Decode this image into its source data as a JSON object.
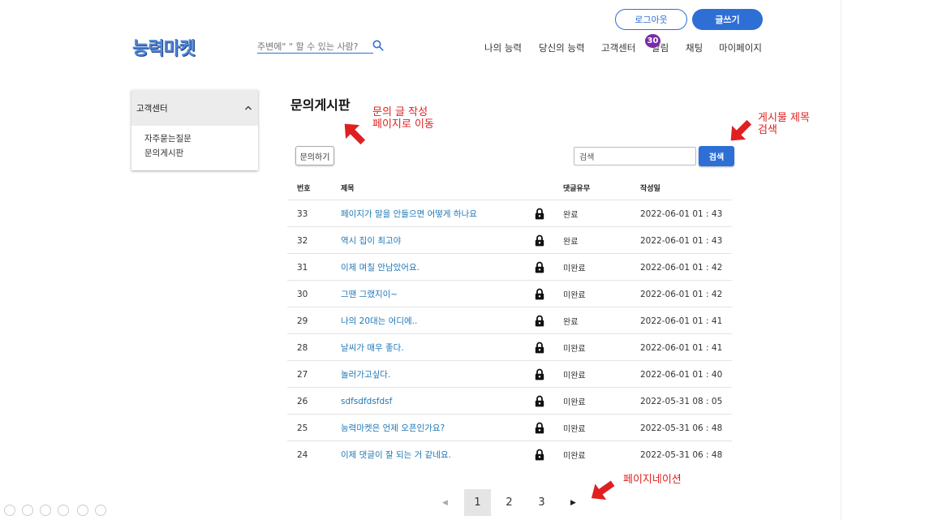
{
  "header": {
    "logout_label": "로그아웃",
    "write_label": "글쓰기",
    "logo_text": "능력마켓",
    "search_placeholder": "주변에\" \" 할 수 있는 사람?",
    "nav": [
      "나의 능력",
      "당신의 능력",
      "고객센터",
      "알림",
      "채팅",
      "마이페이지"
    ],
    "notification_count": "30"
  },
  "sidebar": {
    "title": "고객센터",
    "items": [
      "자주묻는질문",
      "문의게시판"
    ]
  },
  "main": {
    "title": "문의게시판",
    "inquire_label": "문의하기",
    "search_value": "검색",
    "search_button": "검색",
    "columns": [
      "번호",
      "제목",
      "댓글유무",
      "작성일"
    ],
    "rows": [
      {
        "num": "33",
        "title": "페이지가 말을 안들으면 어떻게 하나요",
        "status": "완료",
        "date": "2022-06-01 01 : 43"
      },
      {
        "num": "32",
        "title": "역시 집이 최고야",
        "status": "완료",
        "date": "2022-06-01 01 : 43"
      },
      {
        "num": "31",
        "title": "이제 며칠 안남았어요.",
        "status": "미완료",
        "date": "2022-06-01 01 : 42"
      },
      {
        "num": "30",
        "title": "그땐 그랬지이~",
        "status": "미완료",
        "date": "2022-06-01 01 : 42"
      },
      {
        "num": "29",
        "title": "나의 20대는 어디에..",
        "status": "완료",
        "date": "2022-06-01 01 : 41"
      },
      {
        "num": "28",
        "title": "날씨가 매우 좋다.",
        "status": "미완료",
        "date": "2022-06-01 01 : 41"
      },
      {
        "num": "27",
        "title": "놀러가고싶다.",
        "status": "미완료",
        "date": "2022-06-01 01 : 40"
      },
      {
        "num": "26",
        "title": "sdfsdfdsfdsf",
        "status": "미완료",
        "date": "2022-05-31 08 : 05"
      },
      {
        "num": "25",
        "title": "능력마켓은 언제 오픈인가요?",
        "status": "미완료",
        "date": "2022-05-31 06 : 48"
      },
      {
        "num": "24",
        "title": "이제 댓글이 잘 되는 거 같네요.",
        "status": "미완료",
        "date": "2022-05-31 06 : 48"
      }
    ]
  },
  "pagination": {
    "pages": [
      "1",
      "2",
      "3"
    ],
    "current": "1"
  },
  "annotations": {
    "inquire_line1": "문의 글 작성",
    "inquire_line2": "페이지로 이동",
    "search_line1": "게시물 제목",
    "search_line2": "검색",
    "pagination": "페이지네이션"
  },
  "icons": {
    "search": "search-icon",
    "lock": "lock-icon",
    "chevron": "chevron-up-icon",
    "arrow": "red-arrow-icon"
  },
  "colors": {
    "accent": "#2e6fd6",
    "link": "#1e78b8",
    "badge": "#7a2aa8",
    "annotation": "#e02020"
  }
}
